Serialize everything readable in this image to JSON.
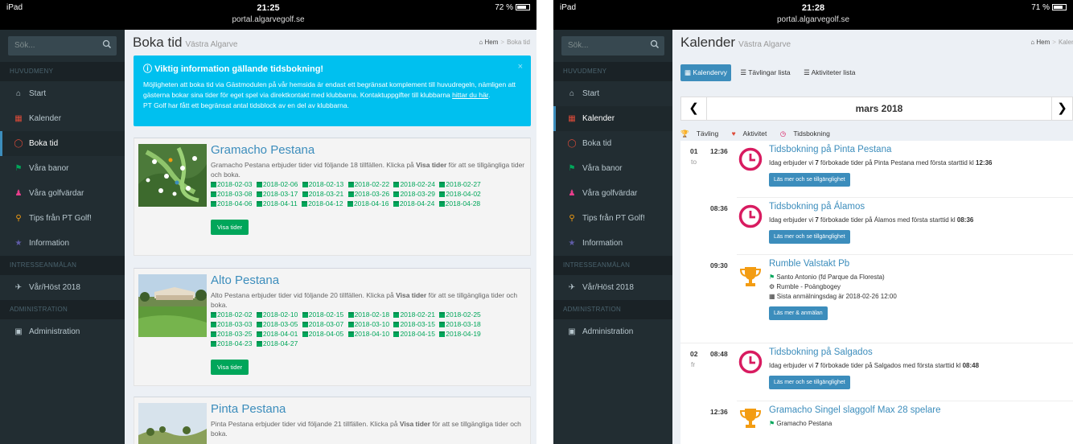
{
  "left": {
    "status": {
      "device": "iPad",
      "time": "21:25",
      "url": "portal.algarvegolf.se",
      "battery": "72 %",
      "battery_level": 0.72
    },
    "sidebar": {
      "search_placeholder": "Sök...",
      "headers": {
        "main": "HUVUDMENY",
        "interest": "INTRESSEANMÄLAN",
        "admin": "ADMINISTRATION"
      },
      "items": [
        {
          "label": "Start",
          "icon": "home-icon"
        },
        {
          "label": "Kalender",
          "icon": "calendar-icon"
        },
        {
          "label": "Boka tid",
          "icon": "circle-icon"
        },
        {
          "label": "Våra banor",
          "icon": "flag-icon"
        },
        {
          "label": "Våra golfvärdar",
          "icon": "person-icon"
        },
        {
          "label": "Tips från PT Golf!",
          "icon": "bulb-icon"
        },
        {
          "label": "Information",
          "icon": "star-icon"
        },
        {
          "label": "Vår/Höst 2018",
          "icon": "plane-icon"
        },
        {
          "label": "Administration",
          "icon": "lock-icon"
        }
      ]
    },
    "page": {
      "title": "Boka tid",
      "subtitle": "Västra Algarve",
      "crumb_home": "Hem",
      "crumb_current": "Boka tid"
    },
    "callout": {
      "title": "Viktig information gällande tidsbokning!",
      "text1": "Möjligheten att boka tid via Gästmodulen på vår hemsida är endast ett begränsat komplement till huvudregeln, nämligen att gästerna bokar sina tider för eget spel via direktkontakt med klubbarna. Kontaktuppgifter till klubbarna ",
      "link": "hittar du här",
      "text2": ".",
      "text3": "PT Golf har fått ett begränsat antal tidsblock av en del av klubbarna."
    },
    "courses": [
      {
        "name": "Gramacho Pestana",
        "desc_a": "Gramacho Pestana erbjuder tider vid följande 18 tillfällen. Klicka på ",
        "desc_b": "Visa tider",
        "desc_c": " för att se tillgängliga tider och boka.",
        "dates": [
          "2018-02-03",
          "2018-02-06",
          "2018-02-13",
          "2018-02-22",
          "2018-02-24",
          "2018-02-27",
          "2018-03-08",
          "2018-03-17",
          "2018-03-21",
          "2018-03-26",
          "2018-03-29",
          "2018-04-02",
          "2018-04-06",
          "2018-04-11",
          "2018-04-12",
          "2018-04-16",
          "2018-04-24",
          "2018-04-28"
        ],
        "button": "Visa tider"
      },
      {
        "name": "Alto Pestana",
        "desc_a": "Alto Pestana erbjuder tider vid följande 20 tillfällen. Klicka på ",
        "desc_b": "Visa tider",
        "desc_c": " för att se tillgängliga tider och boka.",
        "dates": [
          "2018-02-02",
          "2018-02-10",
          "2018-02-15",
          "2018-02-18",
          "2018-02-21",
          "2018-02-25",
          "2018-03-03",
          "2018-03-05",
          "2018-03-07",
          "2018-03-10",
          "2018-03-15",
          "2018-03-18",
          "2018-03-25",
          "2018-04-01",
          "2018-04-05",
          "2018-04-10",
          "2018-04-15",
          "2018-04-19",
          "2018-04-23",
          "2018-04-27"
        ],
        "button": "Visa tider"
      },
      {
        "name": "Pinta Pestana",
        "desc_a": "Pinta Pestana erbjuder tider vid följande 21 tillfällen. Klicka på ",
        "desc_b": "Visa tider",
        "desc_c": " för att se tillgängliga tider och boka.",
        "dates": [],
        "button": ""
      }
    ]
  },
  "right": {
    "status": {
      "device": "iPad",
      "time": "21:28",
      "url": "portal.algarvegolf.se",
      "battery": "71 %",
      "battery_level": 0.71
    },
    "page": {
      "title": "Kalender",
      "subtitle": "Västra Algarve",
      "crumb_home": "Hem",
      "crumb_current": "Kalender"
    },
    "tabs": [
      "Kalendervy",
      "Tävlingar lista",
      "Aktiviteter lista"
    ],
    "month": "mars 2018",
    "legend": [
      "Tävling",
      "Aktivitet",
      "Tidsbokning"
    ],
    "events": [
      {
        "day": "01",
        "dow": "to",
        "time": "12:36",
        "type": "clock",
        "title": "Tidsbokning på Pinta Pestana",
        "text_a": "Idag erbjuder vi ",
        "count": "7",
        "text_b": " förbokade tider på Pinta Pestana med första starttid kl ",
        "start": "12:36",
        "button": "Läs mer och se tillgänglighet"
      },
      {
        "day": "",
        "dow": "",
        "time": "08:36",
        "type": "clock",
        "title": "Tidsbokning på Álamos",
        "text_a": "Idag erbjuder vi ",
        "count": "7",
        "text_b": " förbokade tider på Álamos med första starttid kl ",
        "start": "08:36",
        "button": "Läs mer och se tillgänglighet"
      },
      {
        "day": "",
        "dow": "",
        "time": "09:30",
        "type": "trophy",
        "title": "Rumble Valstakt Pb",
        "line1": "Santo Antonio (fd Parque da Floresta)",
        "line2": "Rumble - Poängbogey",
        "line3": "Sista anmälningsdag är 2018-02-26 12:00",
        "button": "Läs mer & anmälan"
      },
      {
        "day": "02",
        "dow": "fr",
        "time": "08:48",
        "type": "clock",
        "title": "Tidsbokning på Salgados",
        "text_a": "Idag erbjuder vi ",
        "count": "7",
        "text_b": " förbokade tider på Salgados med första starttid kl ",
        "start": "08:48",
        "button": "Läs mer och se tillgänglighet"
      },
      {
        "day": "",
        "dow": "",
        "time": "12:36",
        "type": "trophy",
        "title": "Gramacho Singel slaggolf Max 28 spelare",
        "line1": "Gramacho Pestana"
      }
    ]
  },
  "colors": {
    "sidebar": "#222d32",
    "accent": "#3c8dbc",
    "callout": "#00c0ef",
    "green": "#00a65a",
    "clock": "#d81b60",
    "trophy": "#f39c12"
  }
}
